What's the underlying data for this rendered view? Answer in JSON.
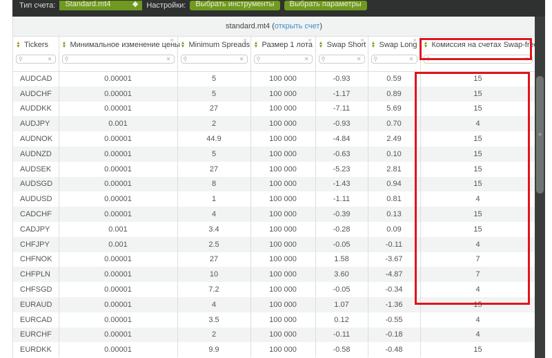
{
  "toolbar": {
    "account_type_label": "Тип счета:",
    "account_type_value": "Standard.mt4",
    "settings_label": "Настройки:",
    "select_instruments": "Выбрать инструменты",
    "select_params": "Выбрать параметры"
  },
  "caption": {
    "account": "standard.mt4",
    "open_prefix": "(",
    "open_link": "открыть счет",
    "open_suffix": ")"
  },
  "columns": [
    "Tickers",
    "Минимальное изменение цены",
    "Minimum Spreads",
    "Размер 1 лота",
    "Swap Short",
    "Swap Long",
    "Комиссия на счетах Swap-free"
  ],
  "rows": [
    [
      "AUDCAD",
      "0.00001",
      "5",
      "100 000",
      "-0.93",
      "0.59",
      "15"
    ],
    [
      "AUDCHF",
      "0.00001",
      "5",
      "100 000",
      "-1.17",
      "0.89",
      "15"
    ],
    [
      "AUDDKK",
      "0.00001",
      "27",
      "100 000",
      "-7.11",
      "5.69",
      "15"
    ],
    [
      "AUDJPY",
      "0.001",
      "2",
      "100 000",
      "-0.93",
      "0.70",
      "4"
    ],
    [
      "AUDNOK",
      "0.00001",
      "44.9",
      "100 000",
      "-4.84",
      "2.49",
      "15"
    ],
    [
      "AUDNZD",
      "0.00001",
      "5",
      "100 000",
      "-0.63",
      "0.10",
      "15"
    ],
    [
      "AUDSEK",
      "0.00001",
      "27",
      "100 000",
      "-5.23",
      "2.81",
      "15"
    ],
    [
      "AUDSGD",
      "0.00001",
      "8",
      "100 000",
      "-1.43",
      "0.94",
      "15"
    ],
    [
      "AUDUSD",
      "0.00001",
      "1",
      "100 000",
      "-1.11",
      "0.81",
      "4"
    ],
    [
      "CADCHF",
      "0.00001",
      "4",
      "100 000",
      "-0.39",
      "0.13",
      "15"
    ],
    [
      "CADJPY",
      "0.001",
      "3.4",
      "100 000",
      "-0.28",
      "0.09",
      "15"
    ],
    [
      "CHFJPY",
      "0.001",
      "2.5",
      "100 000",
      "-0.05",
      "-0.11",
      "4"
    ],
    [
      "CHFNOK",
      "0.00001",
      "27",
      "100 000",
      "1.58",
      "-3.67",
      "7"
    ],
    [
      "CHFPLN",
      "0.00001",
      "10",
      "100 000",
      "3.60",
      "-4.87",
      "7"
    ],
    [
      "CHFSGD",
      "0.00001",
      "7.2",
      "100 000",
      "-0.05",
      "-0.34",
      "4"
    ],
    [
      "EURAUD",
      "0.00001",
      "4",
      "100 000",
      "1.07",
      "-1.36",
      "15"
    ],
    [
      "EURCAD",
      "0.00001",
      "3.5",
      "100 000",
      "0.12",
      "-0.55",
      "4"
    ],
    [
      "EURCHF",
      "0.00001",
      "2",
      "100 000",
      "-0.11",
      "-0.18",
      "4"
    ],
    [
      "EURDKK",
      "0.00001",
      "9.9",
      "100 000",
      "-0.58",
      "-0.48",
      "15"
    ]
  ],
  "colors": {
    "highlight": "#e0141c",
    "accent": "#6f9a1f",
    "link": "#3a8fd0"
  }
}
